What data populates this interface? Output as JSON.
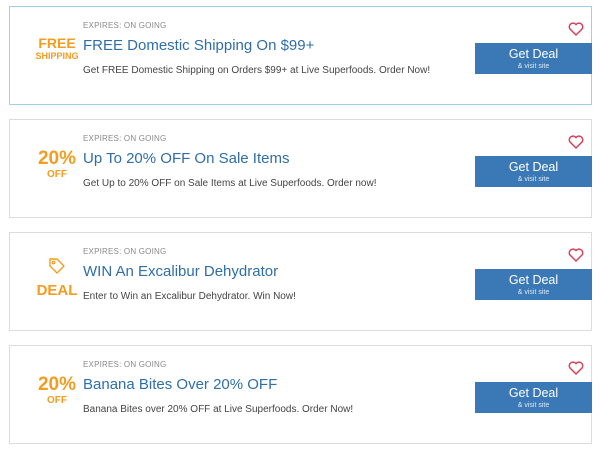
{
  "colors": {
    "accent_orange": "#f39c1f",
    "title_blue": "#2f6ea8",
    "button_blue": "#3a79b6",
    "heart_red": "#d9405a"
  },
  "deals": [
    {
      "badge_type": "shipping",
      "badge_main": "FREE",
      "badge_sub": "SHIPPING",
      "expires": "EXPIRES: ON GOING",
      "title": "FREE Domestic Shipping On $99+",
      "description": "Get FREE Domestic Shipping on Orders $99+ at Live Superfoods. Order Now!",
      "button_label": "Get Deal",
      "button_sublabel": "& visit site",
      "favorite_icon": "heart-outline-icon"
    },
    {
      "badge_type": "percent",
      "badge_main": "20%",
      "badge_sub": "OFF",
      "expires": "EXPIRES: ON GOING",
      "title": "Up To 20% OFF On Sale Items",
      "description": "Get Up to 20% OFF on Sale Items at Live Superfoods. Order now!",
      "button_label": "Get Deal",
      "button_sublabel": "& visit site",
      "favorite_icon": "heart-outline-icon"
    },
    {
      "badge_type": "deal",
      "badge_main": "DEAL",
      "badge_icon": "tag-icon",
      "expires": "EXPIRES: ON GOING",
      "title": "WIN An Excalibur Dehydrator",
      "description": "Enter to Win an Excalibur Dehydrator. Win Now!",
      "button_label": "Get Deal",
      "button_sublabel": "& visit site",
      "favorite_icon": "heart-outline-icon"
    },
    {
      "badge_type": "percent",
      "badge_main": "20%",
      "badge_sub": "OFF",
      "expires": "EXPIRES: ON GOING",
      "title": "Banana Bites Over 20% OFF",
      "description": "Banana Bites over 20% OFF at Live Superfoods. Order Now!",
      "button_label": "Get Deal",
      "button_sublabel": "& visit site",
      "favorite_icon": "heart-outline-icon"
    }
  ]
}
